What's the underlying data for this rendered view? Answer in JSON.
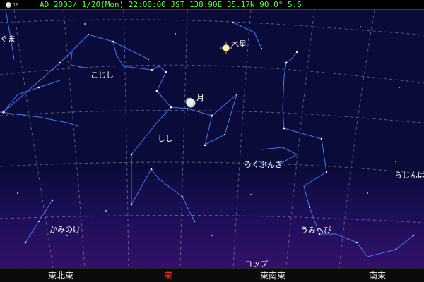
{
  "status_bar": {
    "moon_age": "18",
    "text": "AD 2003/ 1/20(Mon) 22:00:00 JST  138.90E 35.17N   90.0°   5.5"
  },
  "sky_labels": {
    "koguma_partial": "ぐま",
    "kojishi": "こじし",
    "shishi": "しし",
    "rokubungi": "ろくぶんぎ",
    "rashinban_partial": "らしんば",
    "kaminoke": "かみのけ",
    "umihebi": "うみへび",
    "koppu_partial": "コップ",
    "tsuki": "月",
    "mokusei": "木星"
  },
  "bottom_directions": {
    "ene": "東北東",
    "e": "東",
    "ese": "東南東",
    "se": "南東"
  },
  "colors": {
    "status_green": "#4cff4c",
    "constellation_line": "#3c79ff",
    "grid_line": "#9aa0b8",
    "east_red": "#ff2b2b"
  }
}
